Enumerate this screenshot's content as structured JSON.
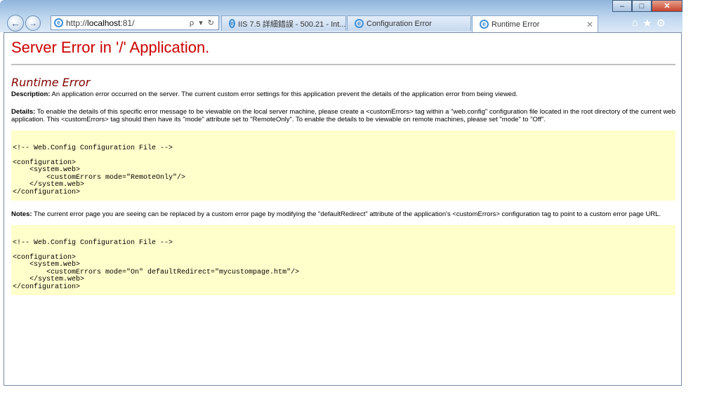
{
  "window": {
    "caption_buttons": [
      "–",
      "□",
      "✕"
    ]
  },
  "toolbar": {
    "back_icon": "back-arrow-icon",
    "forward_icon": "forward-arrow-icon",
    "address_prefix": "http://",
    "address_host": "localhost",
    "address_suffix": ":81/",
    "address_tools": "ρ ▾ ↻",
    "right_icons": [
      "home-icon",
      "favorites-star-icon",
      "tools-gear-icon"
    ]
  },
  "tabs": [
    {
      "title": "IIS 7.5 詳細錯誤 - 500.21 - Int...",
      "active": false
    },
    {
      "title": "Configuration Error",
      "active": false
    },
    {
      "title": "Runtime Error",
      "active": true,
      "close": "✕"
    }
  ],
  "page": {
    "title": "Server Error in '/' Application.",
    "subtitle": "Runtime Error",
    "description_label": "Description:",
    "description_text": " An application error occurred on the server. The current custom error settings for this application prevent the details of the application error from being viewed.",
    "details_label": "Details:",
    "details_text": " To enable the details of this specific error message to be viewable on the local server machine, please create a <customErrors> tag within a \"web.config\" configuration file located in the root directory of the current web application. This <customErrors> tag should then have its \"mode\" attribute set to \"RemoteOnly\". To enable the details to be viewable on remote machines, please set \"mode\" to \"Off\".",
    "code1": "\n<!-- Web.Config Configuration File -->\n\n<configuration>\n    <system.web>\n        <customErrors mode=\"RemoteOnly\"/>\n    </system.web>\n</configuration>",
    "notes_label": "Notes:",
    "notes_text": " The current error page you are seeing can be replaced by a custom error page by modifying the \"defaultRedirect\" attribute of the application's <customErrors> configuration tag to point to a custom error page URL.",
    "code2": "\n<!-- Web.Config Configuration File -->\n\n<configuration>\n    <system.web>\n        <customErrors mode=\"On\" defaultRedirect=\"mycustompage.htm\"/>\n    </system.web>\n</configuration>"
  }
}
